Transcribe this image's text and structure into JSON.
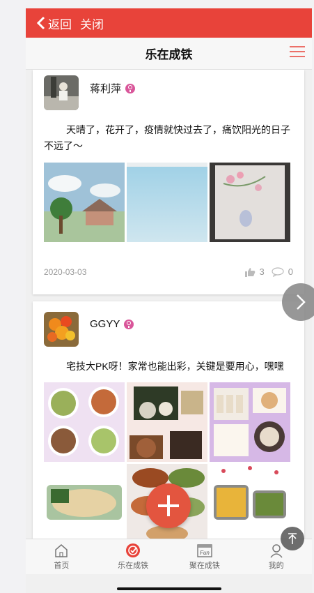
{
  "nav": {
    "back_label": "返回",
    "close_label": "关闭",
    "title": "乐在成铁"
  },
  "posts": [
    {
      "username": "蒋利萍",
      "text": "天晴了，花开了，疫情就快过去了，痛饮阳光的日子不远了～",
      "date": "2020-03-03",
      "likes": "3",
      "comments": "0"
    },
    {
      "username": "GGYY",
      "text": "宅技大PK呀！家常也能出彩，关键是要用心，嘿嘿"
    }
  ],
  "tabs": [
    {
      "label": "首页",
      "icon": "home-icon"
    },
    {
      "label": "乐在成铁",
      "icon": "check-circle-icon"
    },
    {
      "label": "聚在成铁",
      "icon": "fun-icon"
    },
    {
      "label": "我的",
      "icon": "user-icon"
    }
  ],
  "colors": {
    "accent": "#e8433a",
    "fab": "#e3553f",
    "gender_female": "#d9569a"
  }
}
